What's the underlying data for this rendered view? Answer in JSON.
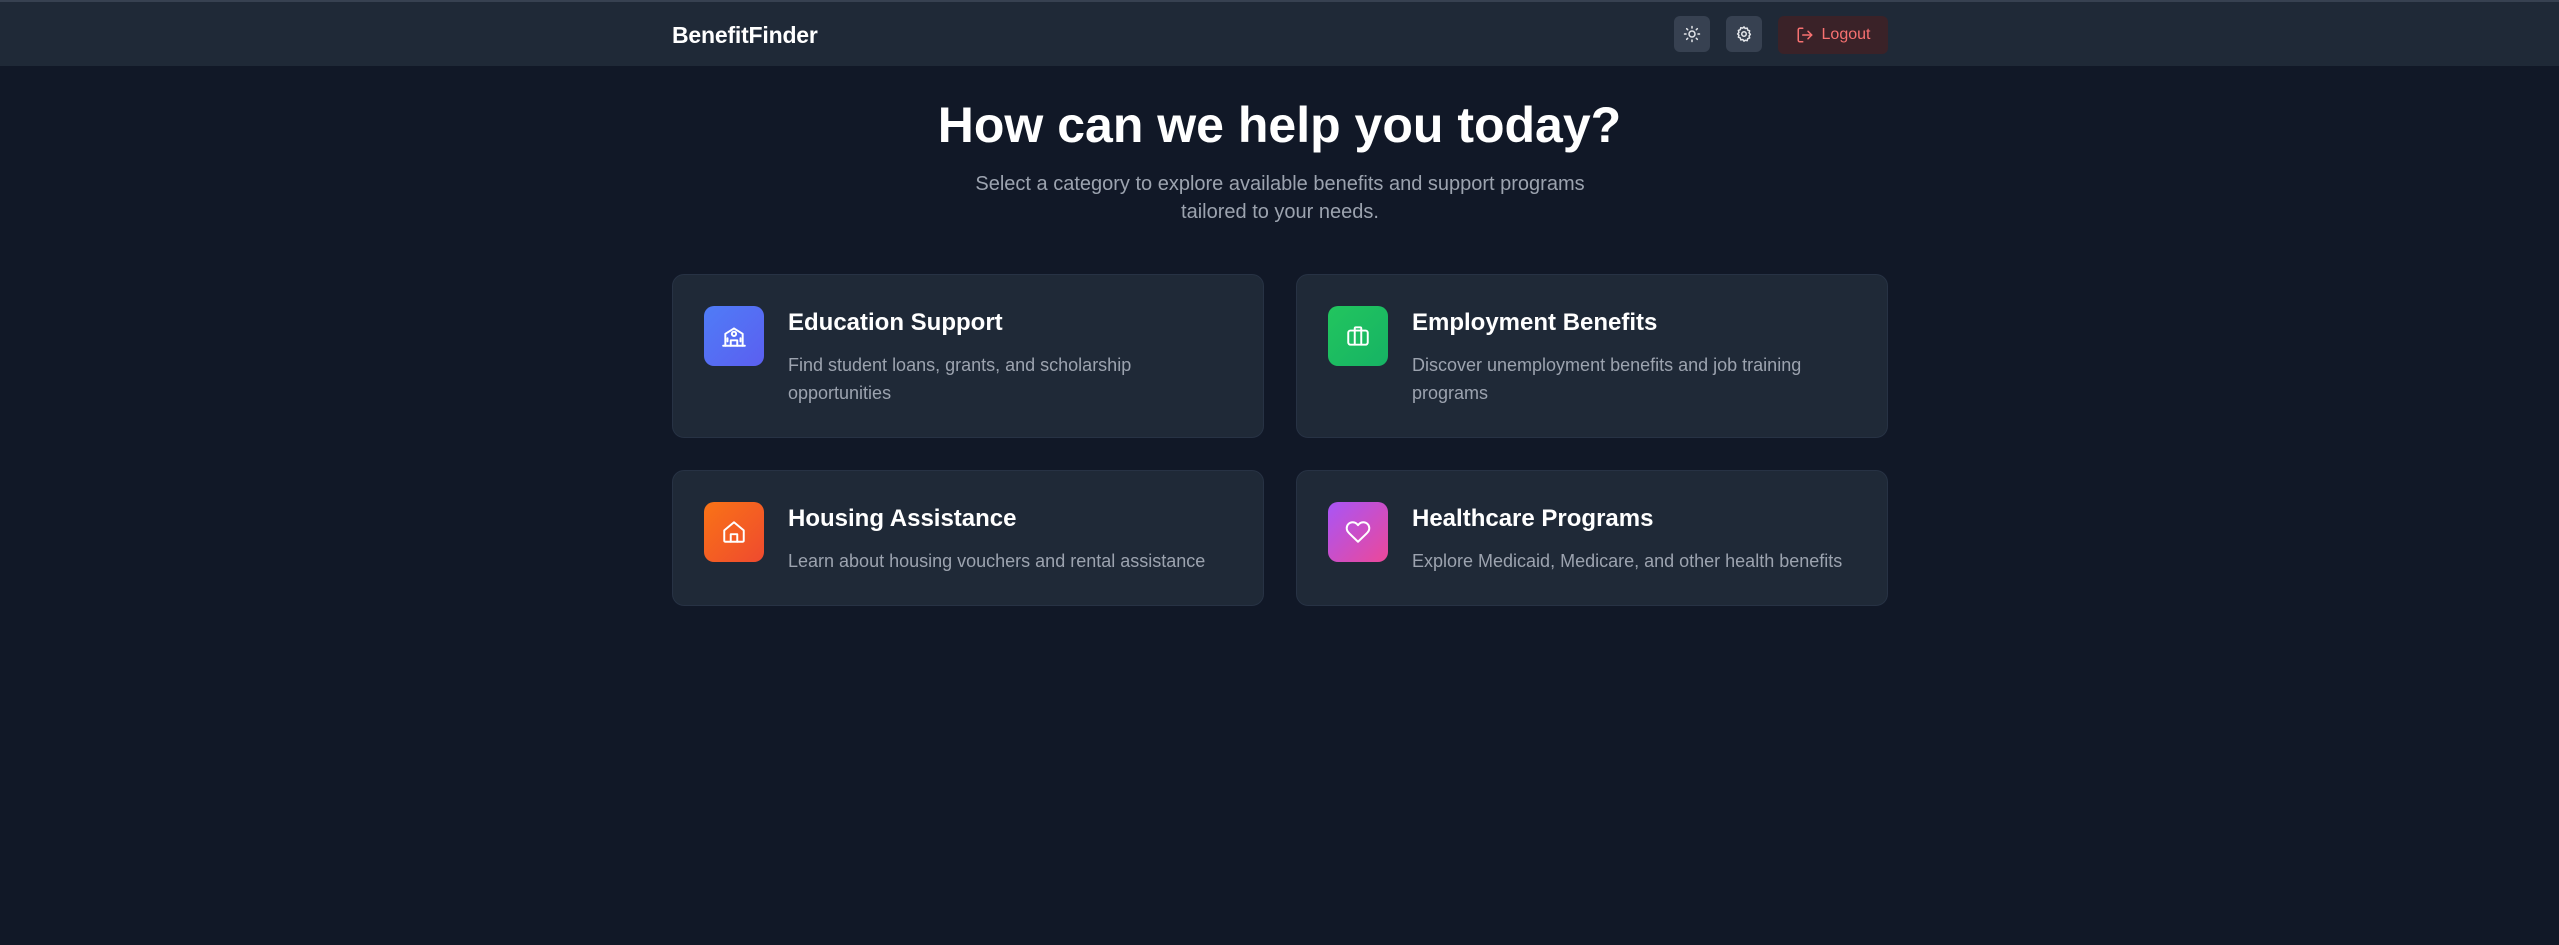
{
  "header": {
    "brand": "BenefitFinder",
    "theme_icon": "sun-icon",
    "settings_icon": "gear-icon",
    "logout_icon": "logout-icon",
    "logout_label": "Logout"
  },
  "hero": {
    "title": "How can we help you today?",
    "subtitle": "Select a category to explore available benefits and support programs tailored to your needs."
  },
  "categories": [
    {
      "title": "Education Support",
      "description": "Find student loans, grants, and scholarship opportunities",
      "icon": "school-icon",
      "color": "#4f6ef7"
    },
    {
      "title": "Employment Benefits",
      "description": "Discover unemployment benefits and job training programs",
      "icon": "briefcase-icon",
      "color": "#22c55e"
    },
    {
      "title": "Housing Assistance",
      "description": "Learn about housing vouchers and rental assistance",
      "icon": "house-icon",
      "color": "#f97316"
    },
    {
      "title": "Healthcare Programs",
      "description": "Explore Medicaid, Medicare, and other health benefits",
      "icon": "heart-icon",
      "color": "#d946ef"
    }
  ],
  "colors": {
    "background": "#111827",
    "surface": "#1f2937",
    "logout_text": "#f87171"
  }
}
